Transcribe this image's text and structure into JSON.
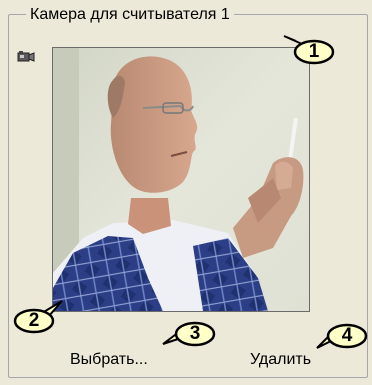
{
  "group": {
    "title": "Камера для считывателя 1"
  },
  "icons": {
    "camera": "camera-icon"
  },
  "video": {
    "content": "camera-snapshot"
  },
  "buttons": {
    "select": "Выбрать...",
    "delete": "Удалить"
  },
  "callouts": [
    "1",
    "2",
    "3",
    "4"
  ],
  "colors": {
    "background": "#ece9d8",
    "border": "#a7a6aa",
    "callout_fill": "#ffffc8"
  }
}
